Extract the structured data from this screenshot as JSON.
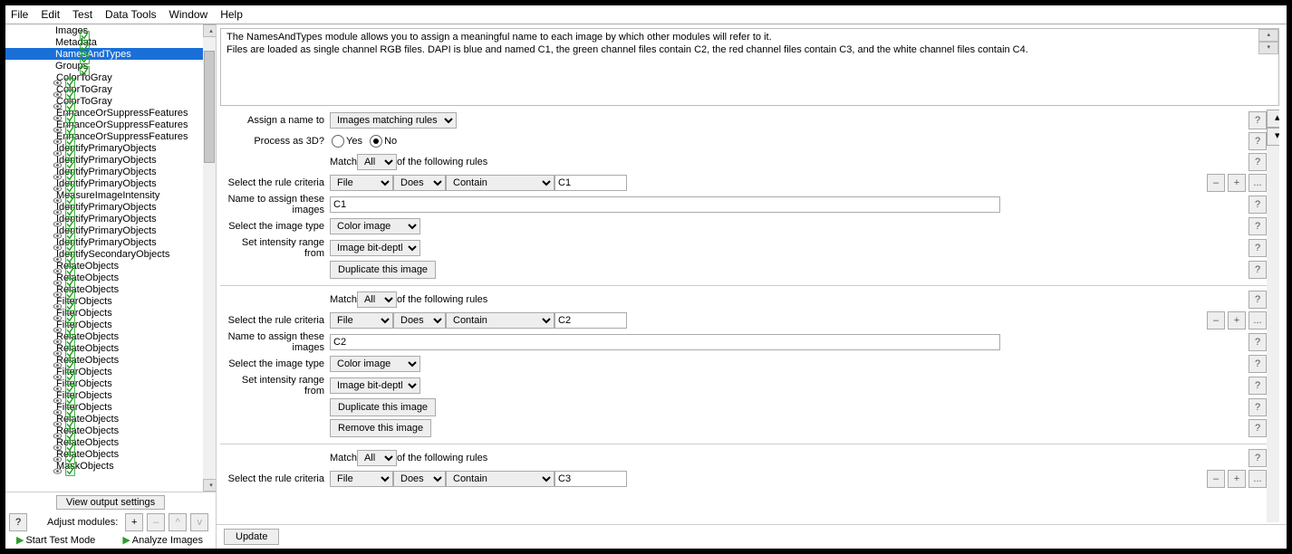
{
  "menu": {
    "items": [
      "File",
      "Edit",
      "Test",
      "Data Tools",
      "Window",
      "Help"
    ]
  },
  "sidebar": {
    "modules": [
      {
        "label": "Images",
        "eye": false,
        "intro": true
      },
      {
        "label": "Metadata",
        "eye": false,
        "intro": true
      },
      {
        "label": "NamesAndTypes",
        "eye": false,
        "intro": true,
        "selected": true
      },
      {
        "label": "Groups",
        "eye": false,
        "intro": true
      },
      {
        "label": "ColorToGray",
        "eye": true
      },
      {
        "label": "ColorToGray",
        "eye": true
      },
      {
        "label": "ColorToGray",
        "eye": true
      },
      {
        "label": "EnhanceOrSuppressFeatures",
        "eye": true
      },
      {
        "label": "EnhanceOrSuppressFeatures",
        "eye": true
      },
      {
        "label": "EnhanceOrSuppressFeatures",
        "eye": true
      },
      {
        "label": "IdentifyPrimaryObjects",
        "eye": true
      },
      {
        "label": "IdentifyPrimaryObjects",
        "eye": true
      },
      {
        "label": "IdentifyPrimaryObjects",
        "eye": true
      },
      {
        "label": "IdentifyPrimaryObjects",
        "eye": true
      },
      {
        "label": "MeasureImageIntensity",
        "eye": true
      },
      {
        "label": "IdentifyPrimaryObjects",
        "eye": true
      },
      {
        "label": "IdentifyPrimaryObjects",
        "eye": true
      },
      {
        "label": "IdentifyPrimaryObjects",
        "eye": true
      },
      {
        "label": "IdentifyPrimaryObjects",
        "eye": true
      },
      {
        "label": "IdentifySecondaryObjects",
        "eye": true
      },
      {
        "label": "RelateObjects",
        "eye": true
      },
      {
        "label": "RelateObjects",
        "eye": true
      },
      {
        "label": "RelateObjects",
        "eye": true
      },
      {
        "label": "FilterObjects",
        "eye": true
      },
      {
        "label": "FilterObjects",
        "eye": true
      },
      {
        "label": "FilterObjects",
        "eye": true
      },
      {
        "label": "RelateObjects",
        "eye": true
      },
      {
        "label": "RelateObjects",
        "eye": true
      },
      {
        "label": "RelateObjects",
        "eye": true
      },
      {
        "label": "FilterObjects",
        "eye": true
      },
      {
        "label": "FilterObjects",
        "eye": true
      },
      {
        "label": "FilterObjects",
        "eye": true
      },
      {
        "label": "FilterObjects",
        "eye": true
      },
      {
        "label": "RelateObjects",
        "eye": true
      },
      {
        "label": "RelateObjects",
        "eye": true
      },
      {
        "label": "RelateObjects",
        "eye": true
      },
      {
        "label": "RelateObjects",
        "eye": true
      },
      {
        "label": "MaskObjects",
        "eye": true
      }
    ],
    "viewOutput": "View output settings",
    "adjust": {
      "label": "Adjust modules:",
      "plus": "+",
      "minus": "–",
      "up": "^",
      "down": "v",
      "help": "?"
    },
    "run": {
      "start": "Start Test Mode",
      "analyze": "Analyze Images"
    }
  },
  "help": {
    "line1": "The NamesAndTypes module allows you to assign a meaningful name to each image by which other modules will refer to it.",
    "line2": "Files are loaded as single channel RGB files. DAPI is blue and named C1, the green channel files contain C2, the red channel files contain C3, and the white channel files contain C4."
  },
  "settings": {
    "assignLabel": "Assign a name to",
    "assignValue": "Images matching rules",
    "process3dLabel": "Process as 3D?",
    "yes": "Yes",
    "no": "No",
    "process3dValue": "No",
    "matchPrefix": "Match",
    "matchAll": "All",
    "matchSuffix": "of the following rules",
    "ruleLabel": "Select the rule criteria",
    "ruleFile": "File",
    "ruleDoes": "Does",
    "ruleContain": "Contain",
    "nameLabel": "Name to assign these images",
    "typeLabel": "Select the image type",
    "typeValue": "Color image",
    "intensityLabel": "Set intensity range from",
    "intensityValue": "Image bit-depth",
    "duplicate": "Duplicate this image",
    "remove": "Remove this image",
    "blocks": [
      {
        "criteria": "C1",
        "name": "C1",
        "showRemove": false
      },
      {
        "criteria": "C2",
        "name": "C2",
        "showRemove": true
      },
      {
        "criteria": "C3",
        "name": "",
        "showRemove": true,
        "partial": true
      }
    ],
    "ruleBtns": {
      "minus": "–",
      "plus": "+",
      "ell": "..."
    },
    "q": "?"
  },
  "footer": {
    "update": "Update"
  }
}
